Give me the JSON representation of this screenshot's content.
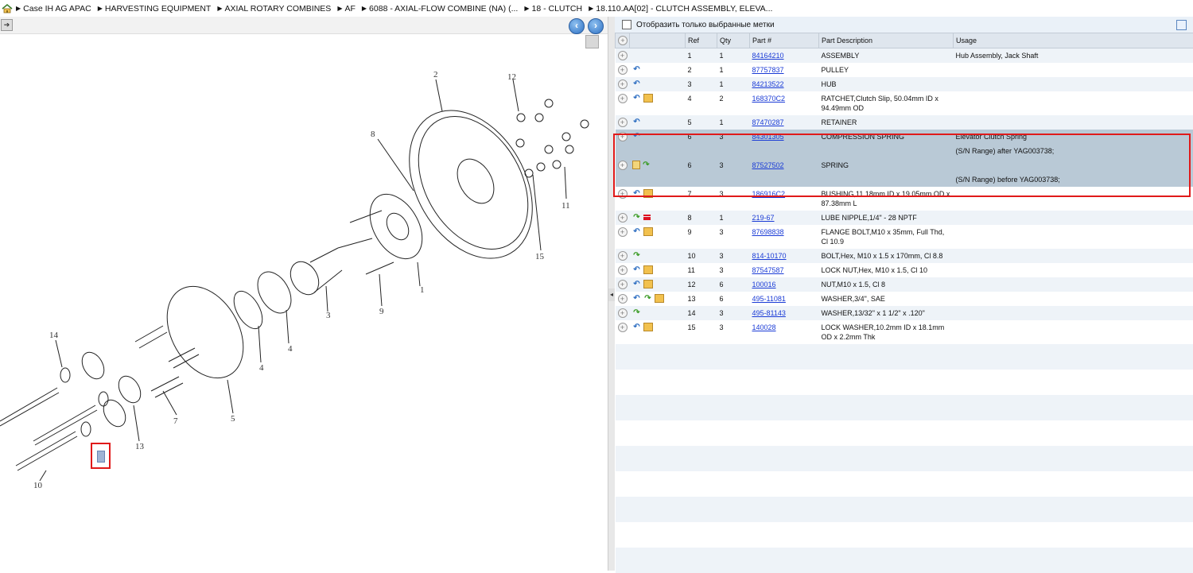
{
  "breadcrumb": {
    "items": [
      "Case IH AG APAC",
      "HARVESTING EQUIPMENT",
      "AXIAL ROTARY COMBINES",
      "AF",
      "6088 - AXIAL-FLOW COMBINE (NA) (...",
      "18 - CLUTCH",
      "18.110.AA[02] - CLUTCH ASSEMBLY, ELEVA..."
    ]
  },
  "filter": {
    "label": "Отобразить только выбранные метки"
  },
  "table": {
    "headers": {
      "ref": "Ref",
      "qty": "Qty",
      "part": "Part #",
      "desc": "Part Description",
      "usage": "Usage"
    }
  },
  "rows": [
    {
      "ref": "1",
      "qty": "1",
      "part": "84164210",
      "desc": "ASSEMBLY",
      "usage": "Hub Assembly, Jack Shaft",
      "icons": []
    },
    {
      "ref": "2",
      "qty": "1",
      "part": "87757837",
      "desc": "PULLEY",
      "usage": "",
      "icons": [
        "back-arrow-icon"
      ]
    },
    {
      "ref": "3",
      "qty": "1",
      "part": "84213522",
      "desc": "HUB",
      "usage": "",
      "icons": [
        "back-arrow-icon"
      ]
    },
    {
      "ref": "4",
      "qty": "2",
      "part": "168370C2",
      "desc": "RATCHET,Clutch Slip, 50.04mm ID x 94.49mm OD",
      "usage": "",
      "icons": [
        "back-arrow-icon",
        "box-icon"
      ]
    },
    {
      "ref": "5",
      "qty": "1",
      "part": "87470287",
      "desc": "RETAINER",
      "usage": "",
      "icons": [
        "back-arrow-icon"
      ]
    },
    {
      "ref": "6",
      "qty": "3",
      "part": "84301305",
      "desc": "COMPRESSION SPRING",
      "usage": "Elevator Clutch Spring",
      "note": "(S/N Range) after YAG003738;",
      "icons": [
        "back-arrow-icon"
      ]
    },
    {
      "ref": "6",
      "qty": "3",
      "part": "87527502",
      "desc": "SPRING",
      "usage": "",
      "note": "(S/N Range) before YAG003738;",
      "icons": [
        "document-icon",
        "forward-arrow-icon"
      ]
    },
    {
      "ref": "7",
      "qty": "3",
      "part": "186916C2",
      "desc": "BUSHING,11.18mm ID x 19.05mm OD x 87.38mm L",
      "usage": "",
      "icons": [
        "back-arrow-icon",
        "box-icon"
      ]
    },
    {
      "ref": "8",
      "qty": "1",
      "part": "219-67",
      "desc": "LUBE NIPPLE,1/4\" - 28 NPTF",
      "usage": "",
      "icons": [
        "forward-arrow-icon",
        "list-icon"
      ]
    },
    {
      "ref": "9",
      "qty": "3",
      "part": "87698838",
      "desc": "FLANGE BOLT,M10 x 35mm, Full Thd, Cl 10.9",
      "usage": "",
      "icons": [
        "back-arrow-icon",
        "box-icon"
      ]
    },
    {
      "ref": "10",
      "qty": "3",
      "part": "814-10170",
      "desc": "BOLT,Hex, M10 x 1.5 x 170mm, Cl 8.8",
      "usage": "",
      "icons": [
        "forward-arrow-icon"
      ]
    },
    {
      "ref": "11",
      "qty": "3",
      "part": "87547587",
      "desc": "LOCK NUT,Hex, M10 x 1.5, Cl 10",
      "usage": "",
      "icons": [
        "back-arrow-icon",
        "box-icon"
      ]
    },
    {
      "ref": "12",
      "qty": "6",
      "part": "100016",
      "desc": "NUT,M10 x 1.5, Cl 8",
      "usage": "",
      "icons": [
        "back-arrow-icon",
        "box-icon"
      ]
    },
    {
      "ref": "13",
      "qty": "6",
      "part": "495-11081",
      "desc": "WASHER,3/4\", SAE",
      "usage": "",
      "icons": [
        "back-arrow-icon",
        "forward-arrow-icon",
        "box-icon"
      ]
    },
    {
      "ref": "14",
      "qty": "3",
      "part": "495-81143",
      "desc": "WASHER,13/32\" x 1 1/2\" x .120\"",
      "usage": "",
      "icons": [
        "forward-arrow-icon"
      ]
    },
    {
      "ref": "15",
      "qty": "3",
      "part": "140028",
      "desc": "LOCK WASHER,10.2mm ID x 18.1mm OD x 2.2mm Thk",
      "usage": "",
      "icons": [
        "back-arrow-icon",
        "box-icon"
      ]
    }
  ],
  "diagram": {
    "callouts": [
      "1",
      "2",
      "3",
      "4",
      "4",
      "5",
      "7",
      "8",
      "9",
      "10",
      "11",
      "12",
      "13",
      "14",
      "15"
    ]
  },
  "colors": {
    "highlight": "#e01a1a",
    "link": "#1a3bd6",
    "selected_row": "#b9c9d6",
    "alt_row": "#eef3f8"
  }
}
